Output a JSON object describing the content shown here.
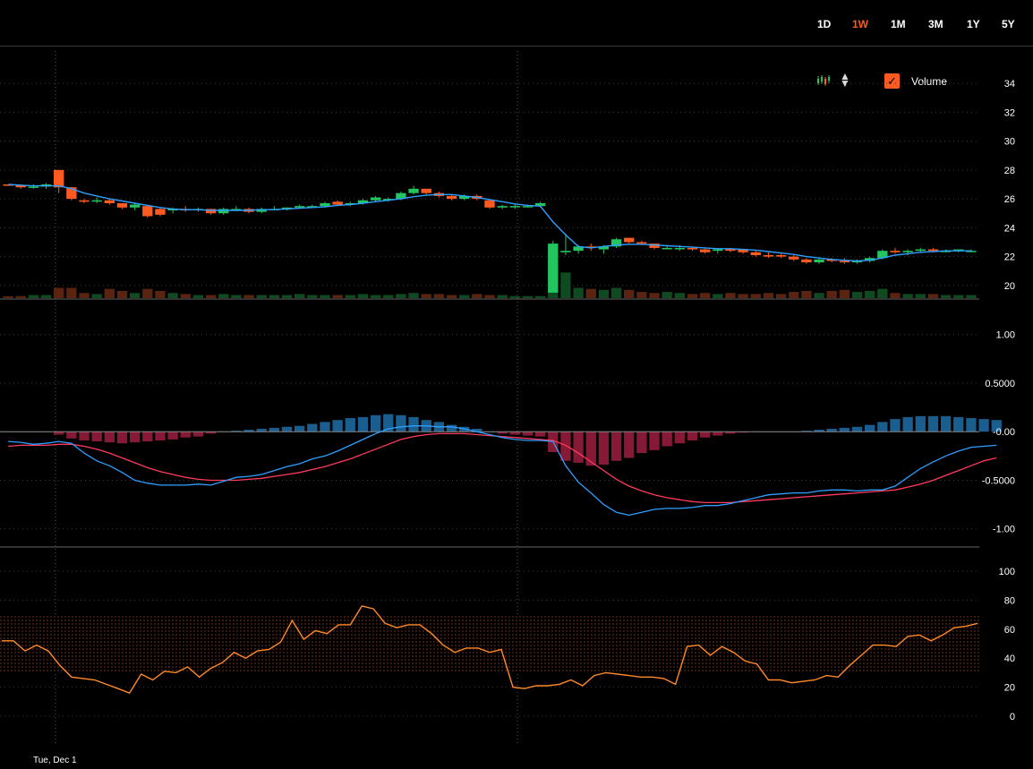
{
  "ranges": [
    {
      "label": "1D",
      "active": false
    },
    {
      "label": "1W",
      "active": true
    },
    {
      "label": "1M",
      "active": false
    },
    {
      "label": "3M",
      "active": false
    },
    {
      "label": "1Y",
      "active": false
    },
    {
      "label": "5Y",
      "active": false
    }
  ],
  "controls": {
    "volume_label": "Volume",
    "volume_checked": true
  },
  "x_axis": {
    "date_label": "Tue, Dec 1"
  },
  "colors": {
    "up": "#22c55e",
    "down": "#ff5a1f",
    "ma": "#2f9fff",
    "macd": "#2f9fff",
    "signal": "#ff3b5c",
    "hist_pos": "#1e6ea8",
    "hist_neg": "#9e1f3f",
    "rsi": "#ff8a2a",
    "accent": "#ff5a1f"
  },
  "chart_data": [
    {
      "type": "candlestick",
      "y_ticks": [
        "34",
        "32",
        "30",
        "28",
        "26",
        "24",
        "22",
        "20"
      ],
      "ylim": [
        19,
        35
      ],
      "candles": [
        [
          27.0,
          27.0,
          26.9,
          26.95
        ],
        [
          26.95,
          27.0,
          26.7,
          26.8
        ],
        [
          26.8,
          27.0,
          26.7,
          26.85
        ],
        [
          26.85,
          27.1,
          26.7,
          27.0
        ],
        [
          28.0,
          28.0,
          26.4,
          26.8
        ],
        [
          26.8,
          26.8,
          25.9,
          26.0
        ],
        [
          25.9,
          26.0,
          25.7,
          25.8
        ],
        [
          25.9,
          26.1,
          25.7,
          25.9
        ],
        [
          25.9,
          26.0,
          25.6,
          25.7
        ],
        [
          25.7,
          25.7,
          25.3,
          25.4
        ],
        [
          25.4,
          25.7,
          25.2,
          25.6
        ],
        [
          25.5,
          25.5,
          24.7,
          24.8
        ],
        [
          25.3,
          25.4,
          24.8,
          24.9
        ],
        [
          25.2,
          25.4,
          25.0,
          25.3
        ],
        [
          25.3,
          25.5,
          25.1,
          25.2
        ],
        [
          25.2,
          25.4,
          25.1,
          25.3
        ],
        [
          25.3,
          25.3,
          24.9,
          25.0
        ],
        [
          25.0,
          25.4,
          24.9,
          25.3
        ],
        [
          25.3,
          25.5,
          25.2,
          25.3
        ],
        [
          25.3,
          25.4,
          25.0,
          25.1
        ],
        [
          25.1,
          25.4,
          25.0,
          25.3
        ],
        [
          25.3,
          25.5,
          25.2,
          25.3
        ],
        [
          25.3,
          25.4,
          25.2,
          25.4
        ],
        [
          25.4,
          25.6,
          25.3,
          25.5
        ],
        [
          25.5,
          25.6,
          25.4,
          25.5
        ],
        [
          25.5,
          25.8,
          25.4,
          25.7
        ],
        [
          25.8,
          25.9,
          25.5,
          25.6
        ],
        [
          25.6,
          25.8,
          25.5,
          25.7
        ],
        [
          25.7,
          26.0,
          25.6,
          25.9
        ],
        [
          25.9,
          26.2,
          25.8,
          26.1
        ],
        [
          26.0,
          26.1,
          25.8,
          26.0
        ],
        [
          26.0,
          26.5,
          25.9,
          26.4
        ],
        [
          26.4,
          26.9,
          26.3,
          26.7
        ],
        [
          26.7,
          26.7,
          26.3,
          26.4
        ],
        [
          26.4,
          26.5,
          26.1,
          26.2
        ],
        [
          26.2,
          26.3,
          25.9,
          26.0
        ],
        [
          26.0,
          26.3,
          25.9,
          26.2
        ],
        [
          26.2,
          26.3,
          25.9,
          26.0
        ],
        [
          25.9,
          25.9,
          25.3,
          25.4
        ],
        [
          25.4,
          25.6,
          25.3,
          25.5
        ],
        [
          25.5,
          25.6,
          25.3,
          25.5
        ],
        [
          25.5,
          25.6,
          25.4,
          25.5
        ],
        [
          25.5,
          25.8,
          25.4,
          25.7
        ],
        [
          19.5,
          23.1,
          19.5,
          22.9
        ],
        [
          22.3,
          23.6,
          22.1,
          22.4
        ],
        [
          22.4,
          22.8,
          22.2,
          22.7
        ],
        [
          22.7,
          22.9,
          22.4,
          22.6
        ],
        [
          22.5,
          22.8,
          22.2,
          22.7
        ],
        [
          22.7,
          23.3,
          22.6,
          23.2
        ],
        [
          23.3,
          23.3,
          22.9,
          23.0
        ],
        [
          23.0,
          23.1,
          22.8,
          22.9
        ],
        [
          22.9,
          22.9,
          22.5,
          22.6
        ],
        [
          22.6,
          22.8,
          22.5,
          22.6
        ],
        [
          22.6,
          22.8,
          22.4,
          22.6
        ],
        [
          22.6,
          22.7,
          22.4,
          22.5
        ],
        [
          22.5,
          22.6,
          22.2,
          22.3
        ],
        [
          22.4,
          22.6,
          22.2,
          22.5
        ],
        [
          22.5,
          22.6,
          22.3,
          22.4
        ],
        [
          22.5,
          22.5,
          22.2,
          22.3
        ],
        [
          22.3,
          22.4,
          22.0,
          22.1
        ],
        [
          22.1,
          22.3,
          21.9,
          22.0
        ],
        [
          22.1,
          22.2,
          21.9,
          22.0
        ],
        [
          22.0,
          22.1,
          21.7,
          21.8
        ],
        [
          21.8,
          21.9,
          21.5,
          21.6
        ],
        [
          21.6,
          21.9,
          21.5,
          21.8
        ],
        [
          21.8,
          21.9,
          21.6,
          21.7
        ],
        [
          21.7,
          21.9,
          21.5,
          21.6
        ],
        [
          21.6,
          21.8,
          21.5,
          21.7
        ],
        [
          21.7,
          22.0,
          21.6,
          21.9
        ],
        [
          21.9,
          22.5,
          21.8,
          22.4
        ],
        [
          22.4,
          22.6,
          22.2,
          22.3
        ],
        [
          22.3,
          22.5,
          22.1,
          22.4
        ],
        [
          22.4,
          22.6,
          22.3,
          22.5
        ],
        [
          22.5,
          22.6,
          22.3,
          22.4
        ],
        [
          22.4,
          22.5,
          22.3,
          22.4
        ],
        [
          22.4,
          22.5,
          22.3,
          22.5
        ],
        [
          22.4,
          22.5,
          22.3,
          22.4
        ]
      ],
      "volume": [
        0.1,
        0.2,
        0.3,
        0.3,
        1.0,
        1.0,
        0.5,
        0.4,
        0.9,
        0.7,
        0.5,
        0.9,
        0.7,
        0.5,
        0.4,
        0.3,
        0.3,
        0.4,
        0.3,
        0.3,
        0.3,
        0.3,
        0.3,
        0.4,
        0.3,
        0.3,
        0.3,
        0.3,
        0.4,
        0.3,
        0.3,
        0.4,
        0.5,
        0.4,
        0.4,
        0.3,
        0.3,
        0.4,
        0.3,
        0.3,
        0.2,
        0.2,
        0.2,
        4.8,
        2.5,
        1.0,
        0.9,
        0.8,
        1.0,
        0.8,
        0.6,
        0.5,
        0.6,
        0.5,
        0.4,
        0.5,
        0.4,
        0.5,
        0.4,
        0.4,
        0.5,
        0.4,
        0.6,
        0.7,
        0.5,
        0.7,
        0.8,
        0.6,
        0.7,
        0.9,
        0.5,
        0.4,
        0.4,
        0.4,
        0.3,
        0.3,
        0.3
      ],
      "ma": [
        27.0,
        26.95,
        26.9,
        26.9,
        26.9,
        26.7,
        26.4,
        26.2,
        26.0,
        25.85,
        25.7,
        25.55,
        25.4,
        25.3,
        25.25,
        25.25,
        25.2,
        25.2,
        25.2,
        25.2,
        25.25,
        25.25,
        25.3,
        25.35,
        25.4,
        25.45,
        25.55,
        25.6,
        25.7,
        25.8,
        25.9,
        26.0,
        26.15,
        26.25,
        26.3,
        26.3,
        26.2,
        26.1,
        25.95,
        25.8,
        25.65,
        25.55,
        25.5,
        24.4,
        23.5,
        22.7,
        22.6,
        22.7,
        22.8,
        22.85,
        22.85,
        22.8,
        22.75,
        22.7,
        22.65,
        22.6,
        22.55,
        22.55,
        22.5,
        22.45,
        22.35,
        22.25,
        22.15,
        22.0,
        21.9,
        21.8,
        21.75,
        21.7,
        21.75,
        21.9,
        22.1,
        22.2,
        22.3,
        22.35,
        22.4,
        22.4,
        22.4
      ]
    },
    {
      "type": "macd",
      "y_ticks": [
        "1.00",
        "0.5000",
        "-0.00",
        "-0.5000",
        "-1.00"
      ],
      "ylim": [
        -1.15,
        1.2
      ],
      "macd": [
        -0.1,
        -0.11,
        -0.13,
        -0.12,
        -0.1,
        -0.12,
        -0.22,
        -0.3,
        -0.35,
        -0.42,
        -0.5,
        -0.53,
        -0.55,
        -0.55,
        -0.55,
        -0.54,
        -0.55,
        -0.51,
        -0.47,
        -0.46,
        -0.44,
        -0.4,
        -0.36,
        -0.33,
        -0.28,
        -0.25,
        -0.2,
        -0.14,
        -0.08,
        -0.02,
        0.03,
        0.05,
        0.06,
        0.06,
        0.05,
        0.05,
        0.03,
        0.0,
        -0.03,
        -0.06,
        -0.08,
        -0.09,
        -0.09,
        -0.1,
        -0.35,
        -0.52,
        -0.63,
        -0.75,
        -0.83,
        -0.86,
        -0.83,
        -0.8,
        -0.79,
        -0.79,
        -0.78,
        -0.76,
        -0.76,
        -0.74,
        -0.71,
        -0.68,
        -0.65,
        -0.64,
        -0.63,
        -0.63,
        -0.61,
        -0.6,
        -0.6,
        -0.61,
        -0.6,
        -0.6,
        -0.56,
        -0.47,
        -0.38,
        -0.31,
        -0.25,
        -0.2,
        -0.16,
        -0.15,
        -0.14
      ],
      "signal": [
        -0.15,
        -0.14,
        -0.14,
        -0.14,
        -0.13,
        -0.13,
        -0.15,
        -0.18,
        -0.22,
        -0.27,
        -0.32,
        -0.37,
        -0.41,
        -0.44,
        -0.47,
        -0.49,
        -0.5,
        -0.5,
        -0.5,
        -0.49,
        -0.48,
        -0.46,
        -0.44,
        -0.42,
        -0.39,
        -0.36,
        -0.32,
        -0.28,
        -0.23,
        -0.18,
        -0.13,
        -0.08,
        -0.05,
        -0.03,
        -0.02,
        -0.02,
        -0.02,
        -0.03,
        -0.04,
        -0.05,
        -0.06,
        -0.07,
        -0.08,
        -0.09,
        -0.14,
        -0.22,
        -0.31,
        -0.4,
        -0.49,
        -0.56,
        -0.61,
        -0.65,
        -0.68,
        -0.7,
        -0.72,
        -0.73,
        -0.73,
        -0.73,
        -0.72,
        -0.71,
        -0.7,
        -0.69,
        -0.68,
        -0.67,
        -0.66,
        -0.65,
        -0.64,
        -0.63,
        -0.62,
        -0.61,
        -0.6,
        -0.57,
        -0.54,
        -0.5,
        -0.45,
        -0.4,
        -0.35,
        -0.3,
        -0.27
      ],
      "hist": [
        0.0,
        0.0,
        0.0,
        0.0,
        -0.03,
        -0.07,
        -0.09,
        -0.1,
        -0.11,
        -0.12,
        -0.11,
        -0.1,
        -0.09,
        -0.08,
        -0.06,
        -0.05,
        -0.02,
        0.0,
        0.01,
        0.02,
        0.03,
        0.04,
        0.05,
        0.06,
        0.08,
        0.1,
        0.12,
        0.14,
        0.15,
        0.17,
        0.18,
        0.17,
        0.15,
        0.12,
        0.1,
        0.07,
        0.05,
        0.03,
        0.0,
        -0.02,
        -0.03,
        -0.04,
        -0.05,
        -0.21,
        -0.3,
        -0.32,
        -0.35,
        -0.34,
        -0.3,
        -0.27,
        -0.22,
        -0.19,
        -0.15,
        -0.12,
        -0.09,
        -0.06,
        -0.04,
        -0.02,
        -0.01,
        0.0,
        0.0,
        0.0,
        0.0,
        0.01,
        0.02,
        0.03,
        0.04,
        0.05,
        0.07,
        0.1,
        0.13,
        0.15,
        0.16,
        0.16,
        0.16,
        0.15,
        0.14,
        0.13,
        0.12
      ],
      "lines": [
        "macd",
        "signal"
      ]
    },
    {
      "type": "line",
      "y_ticks": [
        "100",
        "80",
        "60",
        "40",
        "20",
        "0"
      ],
      "ylim": [
        -5,
        103
      ],
      "band": [
        30,
        70
      ],
      "values": [
        52,
        52,
        45,
        49,
        45,
        35,
        27,
        26,
        25,
        22,
        19,
        16,
        29,
        25,
        31,
        30,
        34,
        27,
        33,
        37,
        44,
        40,
        45,
        46,
        51,
        66,
        53,
        59,
        57,
        63,
        63,
        76,
        74,
        64,
        61,
        63,
        63,
        57,
        49,
        44,
        47,
        47,
        44,
        46,
        20,
        19,
        21,
        21,
        22,
        25,
        21,
        28,
        30,
        29,
        28,
        27,
        27,
        26,
        22,
        48,
        49,
        42,
        48,
        44,
        38,
        36,
        25,
        25,
        23,
        24,
        25,
        28,
        27,
        35,
        42,
        49,
        49,
        48,
        55,
        56,
        52,
        56,
        61,
        62,
        64
      ]
    }
  ]
}
